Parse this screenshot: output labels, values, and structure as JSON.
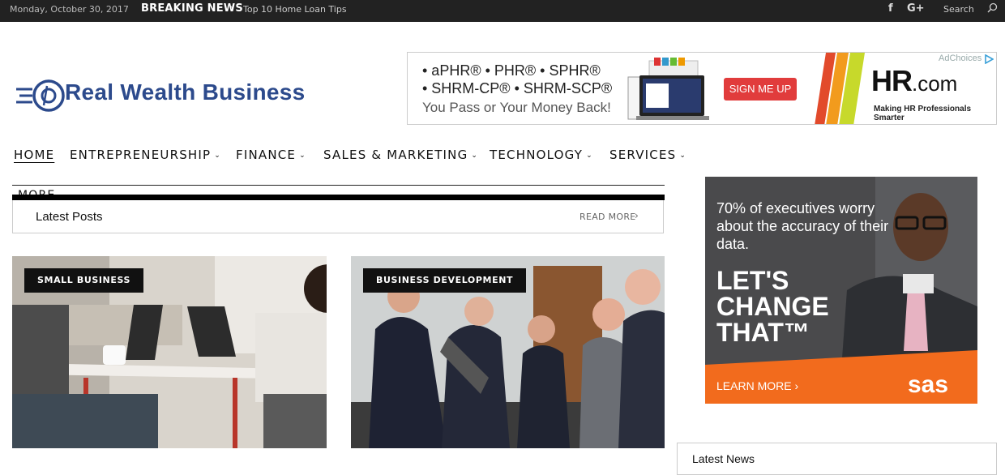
{
  "topbar": {
    "date": "Monday, October 30, 2017",
    "breaking_label": "BREAKING NEWS",
    "breaking_arrow": "›",
    "breaking_text": "Top 10 Home Loan Tips",
    "facebook_glyph": "f",
    "googleplus_glyph": "G+",
    "search_label": "Search"
  },
  "logo": {
    "text": "Real Wealth Business",
    "color": "#2c4a8c"
  },
  "ad_hr": {
    "line1": "• aPHR® • PHR® • SPHR®",
    "line2": "• SHRM-CP® • SHRM-SCP®",
    "line3": "You Pass or Your Money Back!",
    "cta": "SIGN ME UP",
    "brand_main": "HR",
    "brand_suffix": ".com",
    "tagline": "Making HR Professionals Smarter",
    "adchoices": "AdChoices"
  },
  "nav": {
    "items": [
      {
        "label": "HOME"
      },
      {
        "label": "ENTREPRENEURSHIP",
        "chevron": "⌄"
      },
      {
        "label": "FINANCE",
        "chevron": "⌄"
      },
      {
        "label": "SALES & MARKETING",
        "chevron": "⌄"
      },
      {
        "label": "TECHNOLOGY",
        "chevron": "⌄"
      },
      {
        "label": "SERVICES",
        "chevron": "⌄"
      }
    ],
    "more_label": "MORE ⌄"
  },
  "latest_posts": {
    "title": "Latest Posts",
    "read_more": "READ MORE",
    "chevron": "›"
  },
  "cards": [
    {
      "category": "SMALL BUSINESS"
    },
    {
      "category": "BUSINESS DEVELOPMENT"
    }
  ],
  "ad_sas": {
    "headline": "70% of executives worry about the accuracy of their data.",
    "big_line1": "LET'S",
    "big_line2": "CHANGE",
    "big_line3": "THAT™",
    "cta": "LEARN MORE ›",
    "brand": "sas"
  },
  "latest_news": {
    "title": "Latest News"
  },
  "colors": {
    "topbar_bg": "#222222",
    "accent_red": "#e13c3c",
    "sas_orange": "#f26b1d",
    "brand_blue": "#2c4a8c"
  }
}
